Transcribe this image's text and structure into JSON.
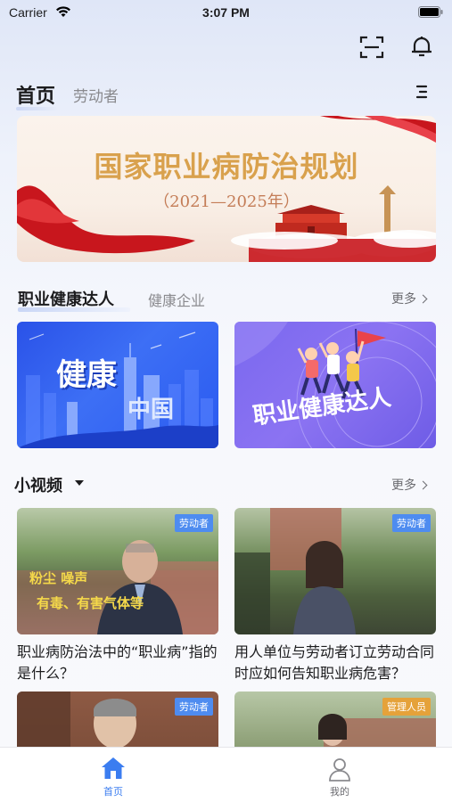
{
  "status_bar": {
    "carrier": "Carrier",
    "time": "3:07 PM"
  },
  "header": {
    "tabs": [
      "首页",
      "劳动者"
    ],
    "active_tab": "首页"
  },
  "banner": {
    "title": "国家职业病防治规划",
    "subtitle": "（2021—2025年）"
  },
  "section_talent": {
    "tabs": [
      "职业健康达人",
      "健康企业"
    ],
    "more": "更多",
    "cards": [
      {
        "label_1": "健康",
        "label_2": "中国"
      },
      {
        "label": "职业健康达人"
      }
    ]
  },
  "section_video": {
    "title": "小视频",
    "more": "更多",
    "videos": [
      {
        "tag": "劳动者",
        "caption_1": "粉尘  噪声",
        "caption_2": "有毒、有害气体等",
        "title": "职业病防治法中的“职业病”指的是什么？"
      },
      {
        "tag": "劳动者",
        "title": "用人单位与劳动者订立劳动合同时应如何告知职业病危害？"
      },
      {
        "tag": "劳动者",
        "title": ""
      },
      {
        "tag": "管理人员",
        "title": ""
      }
    ]
  },
  "tab_bar": {
    "items": [
      {
        "label": "首页",
        "icon": "home-icon",
        "active": true
      },
      {
        "label": "我的",
        "icon": "user-icon",
        "active": false
      }
    ]
  },
  "colors": {
    "accent": "#3b7df0",
    "inactive": "#8a8a8e",
    "tag_blue": "#4e8cf0",
    "tag_orange": "#e5a23a"
  }
}
